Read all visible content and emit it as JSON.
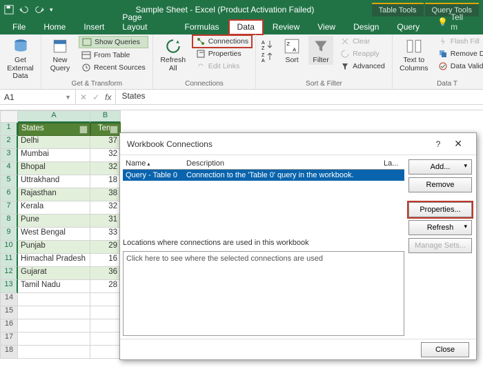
{
  "titlebar": {
    "title": "Sample Sheet - Excel (Product Activation Failed)",
    "ctx1": "Table Tools",
    "ctx2": "Query Tools"
  },
  "tabs": {
    "file": "File",
    "home": "Home",
    "insert": "Insert",
    "pagelayout": "Page Layout",
    "formulas": "Formulas",
    "data": "Data",
    "review": "Review",
    "view": "View",
    "design": "Design",
    "query": "Query",
    "tellme": "Tell m"
  },
  "ribbon": {
    "get_external": "Get External Data",
    "new_query": "New Query",
    "show_queries": "Show Queries",
    "from_table": "From Table",
    "recent_sources": "Recent Sources",
    "gt_label": "Get & Transform",
    "refresh_all": "Refresh All",
    "connections": "Connections",
    "properties": "Properties",
    "edit_links": "Edit Links",
    "conn_label": "Connections",
    "sort": "Sort",
    "filter": "Filter",
    "clear": "Clear",
    "reapply": "Reapply",
    "advanced": "Advanced",
    "sf_label": "Sort & Filter",
    "text_to_cols": "Text to Columns",
    "flash_fill": "Flash Fill",
    "remove_dup": "Remove Dupl",
    "data_valid": "Data Validatio",
    "dt_label": "Data T"
  },
  "formula": {
    "name": "A1",
    "fx": "fx",
    "value": "States"
  },
  "sheet": {
    "colA": "A",
    "colB": "B",
    "headerA": "States",
    "headerB": "Temp",
    "rows": [
      {
        "n": "2",
        "a": "Delhi",
        "b": "37"
      },
      {
        "n": "3",
        "a": "Mumbai",
        "b": "32"
      },
      {
        "n": "4",
        "a": "Bhopal",
        "b": "32"
      },
      {
        "n": "5",
        "a": "Uttrakhand",
        "b": "18"
      },
      {
        "n": "6",
        "a": "Rajasthan",
        "b": "38"
      },
      {
        "n": "7",
        "a": "Kerala",
        "b": "32"
      },
      {
        "n": "8",
        "a": "Pune",
        "b": "31"
      },
      {
        "n": "9",
        "a": "West Bengal",
        "b": "33"
      },
      {
        "n": "10",
        "a": "Punjab",
        "b": "29"
      },
      {
        "n": "11",
        "a": "Himachal Pradesh",
        "b": "16"
      },
      {
        "n": "12",
        "a": "Gujarat",
        "b": "36"
      },
      {
        "n": "13",
        "a": "Tamil Nadu",
        "b": "28"
      }
    ],
    "empty": [
      "14",
      "15",
      "16",
      "17",
      "18"
    ]
  },
  "dialog": {
    "title": "Workbook Connections",
    "help": "?",
    "col_name": "Name",
    "col_desc": "Description",
    "col_last": "La...",
    "row_name": "Query - Table 0",
    "row_desc": "Connection to the 'Table 0' query in the workbook.",
    "loc_label": "Locations where connections are used in this workbook",
    "loc_hint": "Click here to see where the selected connections are used",
    "add": "Add...",
    "remove": "Remove",
    "props": "Properties...",
    "refresh": "Refresh",
    "manage": "Manage Sets...",
    "close": "Close"
  }
}
